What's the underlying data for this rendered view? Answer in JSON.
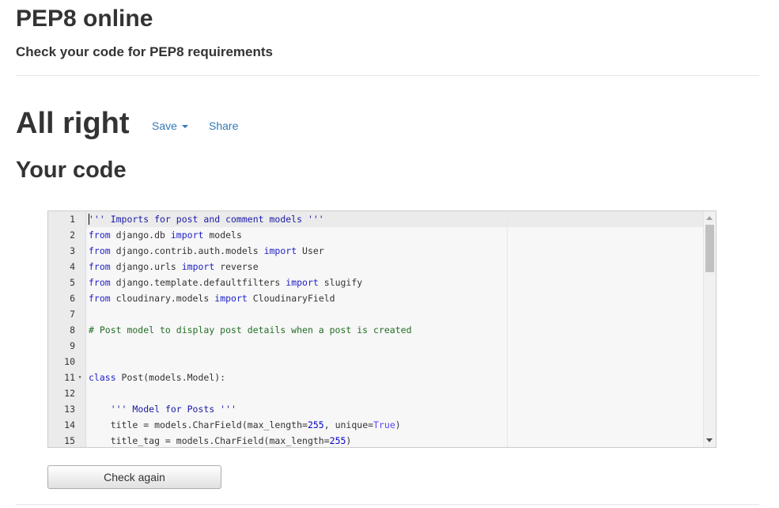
{
  "header": {
    "title": "PEP8 online",
    "subtitle": "Check your code for PEP8 requirements"
  },
  "result": {
    "heading": "All right",
    "save_label": "Save",
    "share_label": "Share"
  },
  "code_section": {
    "heading": "Your code"
  },
  "editor": {
    "lines": [
      {
        "n": "1",
        "fold": "",
        "tokens": [
          {
            "t": "''' Imports for post and comment models '''",
            "c": "str"
          }
        ]
      },
      {
        "n": "2",
        "fold": "",
        "tokens": [
          {
            "t": "from",
            "c": "kw"
          },
          {
            "t": " django.db ",
            "c": "plain"
          },
          {
            "t": "import",
            "c": "kw"
          },
          {
            "t": " models",
            "c": "plain"
          }
        ]
      },
      {
        "n": "3",
        "fold": "",
        "tokens": [
          {
            "t": "from",
            "c": "kw"
          },
          {
            "t": " django.contrib.auth.models ",
            "c": "plain"
          },
          {
            "t": "import",
            "c": "kw"
          },
          {
            "t": " User",
            "c": "plain"
          }
        ]
      },
      {
        "n": "4",
        "fold": "",
        "tokens": [
          {
            "t": "from",
            "c": "kw"
          },
          {
            "t": " django.urls ",
            "c": "plain"
          },
          {
            "t": "import",
            "c": "kw"
          },
          {
            "t": " reverse",
            "c": "plain"
          }
        ]
      },
      {
        "n": "5",
        "fold": "",
        "tokens": [
          {
            "t": "from",
            "c": "kw"
          },
          {
            "t": " django.template.defaultfilters ",
            "c": "plain"
          },
          {
            "t": "import",
            "c": "kw"
          },
          {
            "t": " slugify",
            "c": "plain"
          }
        ]
      },
      {
        "n": "6",
        "fold": "",
        "tokens": [
          {
            "t": "from",
            "c": "kw"
          },
          {
            "t": " cloudinary.models ",
            "c": "plain"
          },
          {
            "t": "import",
            "c": "kw"
          },
          {
            "t": " CloudinaryField",
            "c": "plain"
          }
        ]
      },
      {
        "n": "7",
        "fold": "",
        "tokens": []
      },
      {
        "n": "8",
        "fold": "",
        "tokens": [
          {
            "t": "# Post model to display post details when a post is created",
            "c": "com"
          }
        ]
      },
      {
        "n": "9",
        "fold": "",
        "tokens": []
      },
      {
        "n": "10",
        "fold": "",
        "tokens": []
      },
      {
        "n": "11",
        "fold": "▾",
        "tokens": [
          {
            "t": "class",
            "c": "kw"
          },
          {
            "t": " Post(models.Model):",
            "c": "plain"
          }
        ]
      },
      {
        "n": "12",
        "fold": "",
        "tokens": []
      },
      {
        "n": "13",
        "fold": "",
        "tokens": [
          {
            "t": "    ",
            "c": "plain"
          },
          {
            "t": "''' Model for Posts '''",
            "c": "str"
          }
        ]
      },
      {
        "n": "14",
        "fold": "",
        "tokens": [
          {
            "t": "    title = models.CharField(max_length=",
            "c": "plain"
          },
          {
            "t": "255",
            "c": "num"
          },
          {
            "t": ", unique=",
            "c": "plain"
          },
          {
            "t": "True",
            "c": "bool"
          },
          {
            "t": ")",
            "c": "plain"
          }
        ]
      },
      {
        "n": "15",
        "fold": "",
        "tokens": [
          {
            "t": "    title_tag = models.CharField(max_length=",
            "c": "plain"
          },
          {
            "t": "255",
            "c": "num"
          },
          {
            "t": ")",
            "c": "plain"
          }
        ]
      }
    ],
    "active_line": 1,
    "colors": {
      "keyword": "#1e1ec8",
      "string": "#1a1aa6",
      "comment": "#236e24",
      "number": "#0000cd",
      "boolean": "#5848f6"
    }
  },
  "actions": {
    "check_again_label": "Check again"
  }
}
